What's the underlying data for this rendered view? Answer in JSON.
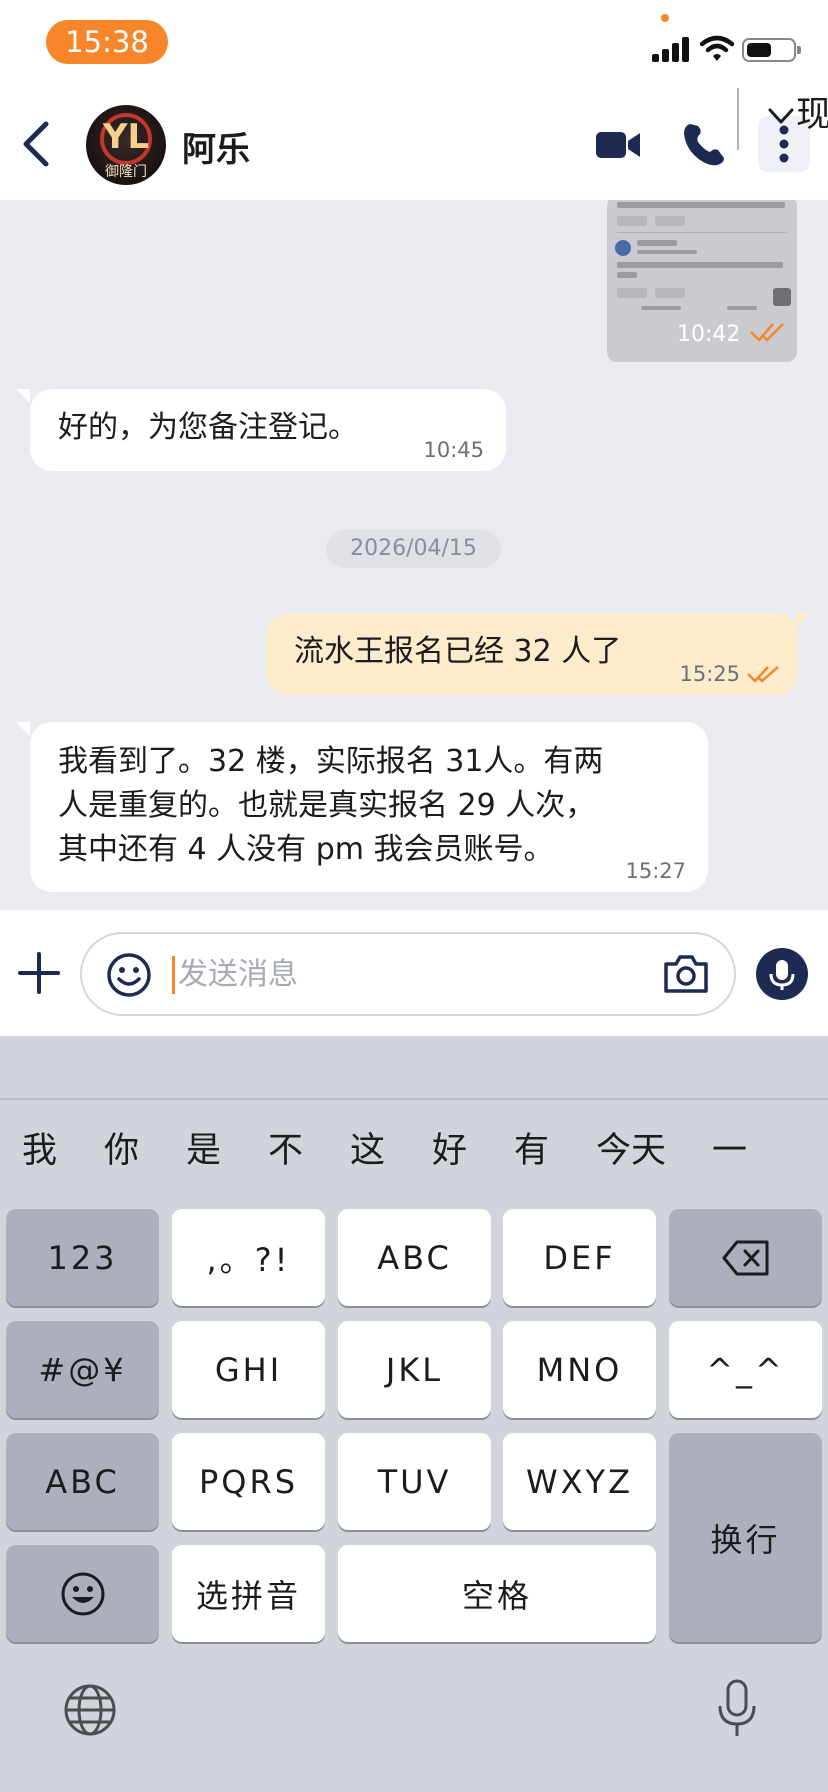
{
  "status_bar": {
    "time": "15:38"
  },
  "header": {
    "contact_name": "阿乐",
    "avatar_text": "御隆门"
  },
  "messages": {
    "image_message": {
      "time": "10:42"
    },
    "incoming_1": {
      "text": "好的，为您备注登记。",
      "time": "10:45"
    },
    "date_separator": "2026/04/15",
    "outgoing_1": {
      "text": "流水王报名已经 32 人了",
      "time": "15:25"
    },
    "incoming_2": {
      "lines": [
        "我看到了。32 楼，实际报名 31人。有两",
        "人是重复的。也就是真实报名 29 人次，",
        "其中还有 4 人没有 pm 我会员账号。"
      ],
      "time": "15:27"
    }
  },
  "input_bar": {
    "placeholder": "发送消息"
  },
  "keyboard": {
    "suggestions": [
      "我",
      "你",
      "是",
      "不",
      "这",
      "好",
      "有",
      "今天",
      "一"
    ],
    "suggestion_tail": "现",
    "keys": {
      "num": "123",
      "punct": ",。?!",
      "abc": "ABC",
      "def": "DEF",
      "sym": "#@¥",
      "ghi": "GHI",
      "jkl": "JKL",
      "mno": "MNO",
      "face": "^_^",
      "abc_switch": "ABC",
      "pqrs": "PQRS",
      "tuv": "TUV",
      "wxyz": "WXYZ",
      "enter": "换行",
      "pinyin": "选拼音",
      "space": "空格"
    }
  },
  "colors": {
    "accent": "#f7862a",
    "navy": "#1d2b52",
    "outgoing_bubble": "#fdeccb",
    "chat_bg": "#e9ebf1"
  }
}
